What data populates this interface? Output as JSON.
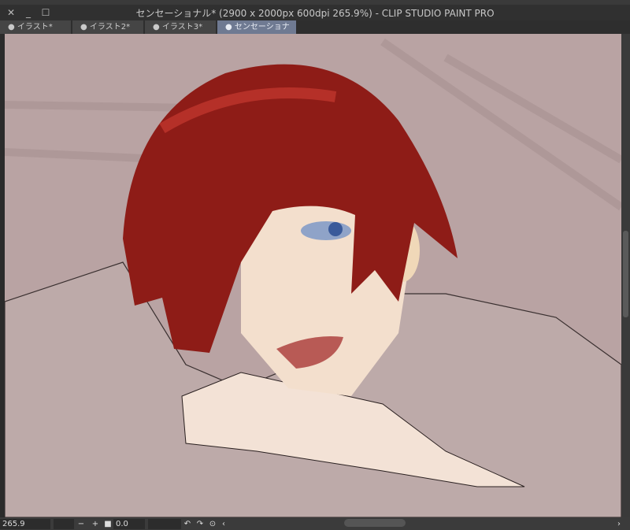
{
  "window": {
    "title": "センセーショナル* (2900 x 2000px 600dpi 265.9%)  - CLIP STUDIO PAINT PRO"
  },
  "tabs": [
    {
      "label": "● イラスト*"
    },
    {
      "label": "● イラスト2*"
    },
    {
      "label": "● イラスト3*"
    },
    {
      "label": "● センセーショナル*",
      "active": true
    }
  ],
  "status": {
    "zoom": "265.9",
    "rotation": "0.0"
  },
  "colors": {
    "canvas_bg": "#b9a3a3",
    "hair": "#8e1c17",
    "skin": "#f2dcc8",
    "active_tab": "#6f7a92"
  }
}
